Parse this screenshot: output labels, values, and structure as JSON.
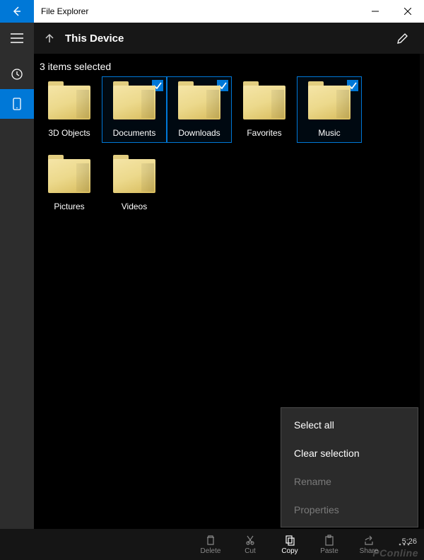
{
  "titlebar": {
    "title": "File Explorer"
  },
  "header": {
    "location": "This Device"
  },
  "status": "3 items selected",
  "rail": {
    "items": [
      {
        "name": "recent-icon"
      },
      {
        "name": "device-icon"
      }
    ],
    "active_index": 1
  },
  "folders": [
    {
      "label": "3D Objects",
      "selected": false
    },
    {
      "label": "Documents",
      "selected": true
    },
    {
      "label": "Downloads",
      "selected": true
    },
    {
      "label": "Favorites",
      "selected": false
    },
    {
      "label": "Music",
      "selected": true
    },
    {
      "label": "Pictures",
      "selected": false
    },
    {
      "label": "Videos",
      "selected": false
    }
  ],
  "context_menu": {
    "items": [
      {
        "label": "Select all",
        "enabled": true
      },
      {
        "label": "Clear selection",
        "enabled": true
      },
      {
        "label": "Rename",
        "enabled": false
      },
      {
        "label": "Properties",
        "enabled": false
      }
    ]
  },
  "toolbar": {
    "items": [
      {
        "label": "Delete",
        "icon": "trash-icon",
        "active": false
      },
      {
        "label": "Cut",
        "icon": "cut-icon",
        "active": false
      },
      {
        "label": "Copy",
        "icon": "copy-icon",
        "active": true
      },
      {
        "label": "Paste",
        "icon": "paste-icon",
        "active": false
      },
      {
        "label": "Share",
        "icon": "share-icon",
        "active": false
      }
    ]
  },
  "watermark": "PConline",
  "clock": "5:26"
}
